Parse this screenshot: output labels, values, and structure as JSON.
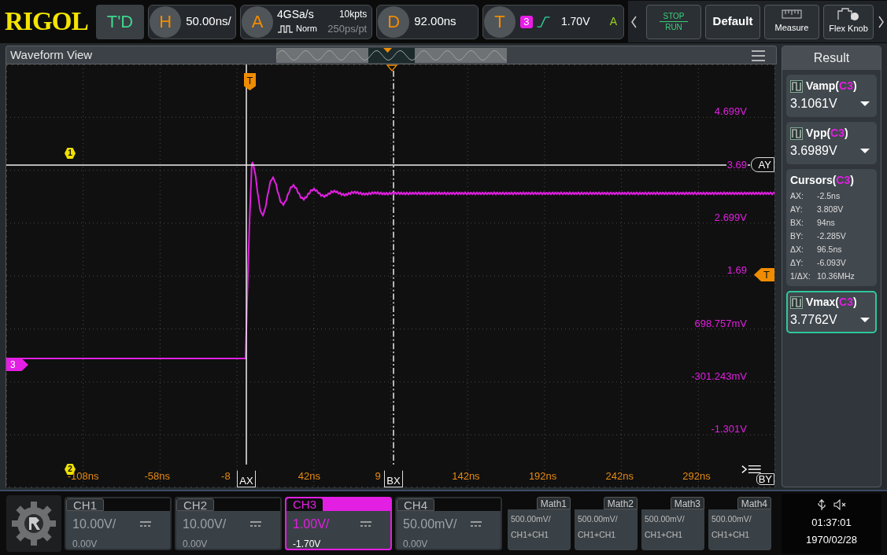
{
  "top_bar": {
    "logo": "RIGOL",
    "mode": "T'D",
    "horizontal": {
      "badge": "H",
      "timebase": "50.00ns/"
    },
    "acquisition": {
      "badge": "A",
      "sample_rate": "4GSa/s",
      "memory_depth": "10kpts",
      "mode": "Norm",
      "resolution": "250ps/pt"
    },
    "delay": {
      "badge": "D",
      "offset": "92.00ns"
    },
    "trigger": {
      "badge": "T",
      "source": "3",
      "level": "1.70V",
      "sweep": "A"
    },
    "buttons": [
      {
        "kind": "run_stop",
        "top": "STOP",
        "bottom": "RUN"
      },
      {
        "kind": "text",
        "label": "Default"
      },
      {
        "kind": "measure",
        "label": "Measure"
      },
      {
        "kind": "knob",
        "label": "Flex Knob"
      }
    ]
  },
  "waveform_view": {
    "title": "Waveform View",
    "y_labels": [
      "4.699V",
      "3.69",
      "2.699V",
      "1.69",
      "698.757mV",
      "-301.243mV",
      "-1.301V"
    ],
    "x_labels": [
      "-108ns",
      "-58ns",
      "-8",
      "42ns",
      "9",
      "142ns",
      "192ns",
      "242ns",
      "292ns"
    ],
    "cursors": [
      {
        "label": "AX"
      },
      {
        "label": "BX"
      },
      {
        "label": "AY"
      },
      {
        "label": "BY"
      }
    ],
    "trigger_markers": [
      "T",
      "T"
    ],
    "channel_marker": "3",
    "reference_markers": [
      "1",
      "2"
    ]
  },
  "result": {
    "title": "Result",
    "items": [
      {
        "kind": "measure",
        "title_parts": [
          "Vamp(",
          "C3",
          ")"
        ],
        "value": "3.1061V",
        "selected": false
      },
      {
        "kind": "measure",
        "title_parts": [
          "Vpp(",
          "C3",
          ")"
        ],
        "value": "3.6989V",
        "selected": false
      },
      {
        "kind": "cursors",
        "title_parts": [
          "Cursors(",
          "C3",
          ")"
        ],
        "rows": [
          {
            "label": "AX:",
            "value": "-2.5ns"
          },
          {
            "label": "AY:",
            "value": "3.808V"
          },
          {
            "label": "BX:",
            "value": "94ns"
          },
          {
            "label": "BY:",
            "value": "-2.285V"
          },
          {
            "label": "ΔX:",
            "value": "96.5ns"
          },
          {
            "label": "ΔY:",
            "value": "-6.093V"
          },
          {
            "label": "1/ΔX:",
            "value": "10.36MHz"
          }
        ],
        "selected": false
      },
      {
        "kind": "measure",
        "title_parts": [
          "Vmax(",
          "C3",
          ")"
        ],
        "value": "3.7762V",
        "selected": true
      }
    ]
  },
  "channels": [
    {
      "label": "CH1",
      "scale": "10.00V/",
      "offset": "0.00V",
      "selected": false
    },
    {
      "label": "CH2",
      "scale": "10.00V/",
      "offset": "0.00V",
      "selected": false
    },
    {
      "label": "CH3",
      "scale": "1.00V/",
      "offset": "-1.70V",
      "selected": true
    },
    {
      "label": "CH4",
      "scale": "50.00mV/",
      "offset": "0.00V",
      "selected": false
    }
  ],
  "math": [
    {
      "label": "Math1",
      "scale": "500.00mV/",
      "expression": "CH1+CH1"
    },
    {
      "label": "Math2",
      "scale": "500.00mV/",
      "expression": "CH1+CH1"
    },
    {
      "label": "Math3",
      "scale": "500.00mV/",
      "expression": "CH1+CH1"
    },
    {
      "label": "Math4",
      "scale": "500.00mV/",
      "expression": "CH1+CH1"
    }
  ],
  "status": {
    "time": "01:37:01",
    "date": "1970/02/28"
  }
}
